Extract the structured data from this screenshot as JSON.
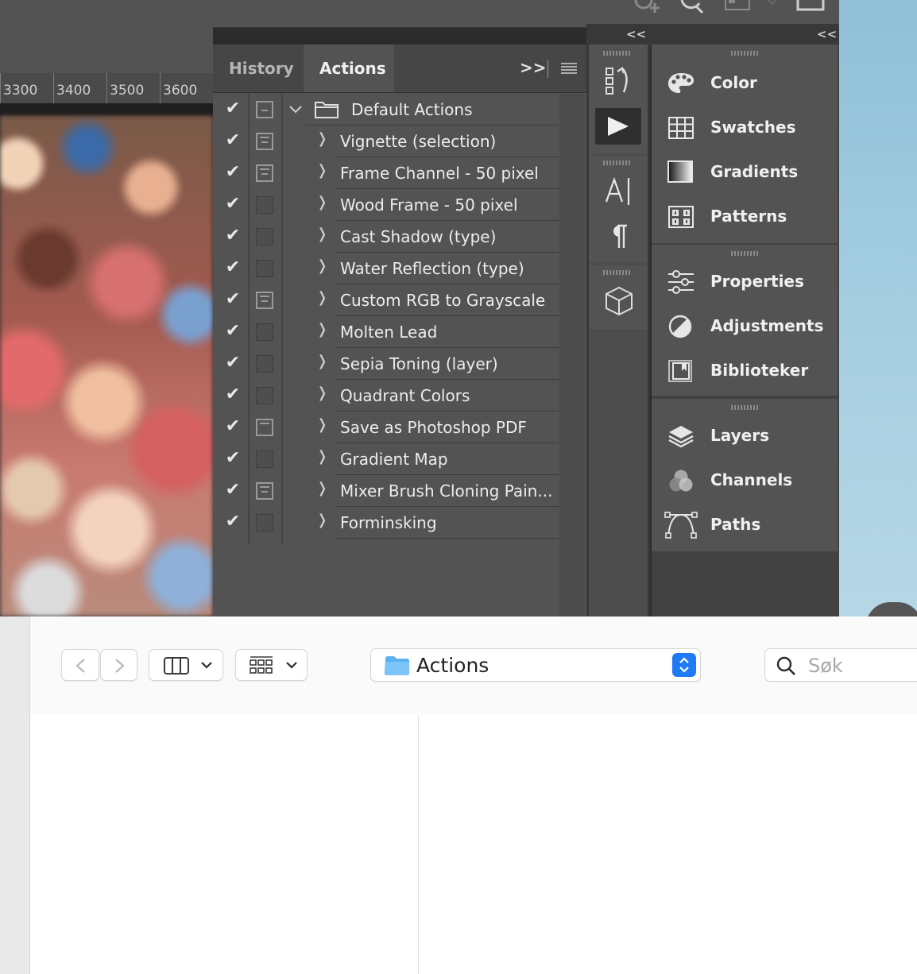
{
  "ruler": {
    "ticks": [
      "3300",
      "3400",
      "3500",
      "3600"
    ]
  },
  "actions_panel": {
    "tabs": [
      {
        "label": "History"
      },
      {
        "label": "Actions"
      }
    ],
    "expand_label": ">>",
    "set": {
      "name": "Default Actions"
    },
    "actions": [
      {
        "name": "Vignette (selection)",
        "dialog": true
      },
      {
        "name": "Frame Channel - 50 pixel",
        "dialog": true
      },
      {
        "name": "Wood Frame - 50 pixel",
        "dialog": false
      },
      {
        "name": "Cast Shadow (type)",
        "dialog": false
      },
      {
        "name": "Water Reflection (type)",
        "dialog": false
      },
      {
        "name": "Custom RGB to Grayscale",
        "dialog": true
      },
      {
        "name": "Molten Lead",
        "dialog": false
      },
      {
        "name": "Sepia Toning (layer)",
        "dialog": false
      },
      {
        "name": "Quadrant Colors",
        "dialog": false
      },
      {
        "name": "Save as Photoshop PDF",
        "dialog": true
      },
      {
        "name": "Gradient Map",
        "dialog": false
      },
      {
        "name": "Mixer Brush Cloning Pain...",
        "dialog": true
      },
      {
        "name": "Forminsking",
        "dialog": false
      }
    ]
  },
  "right_panel": {
    "collapse_label": "<<",
    "groups": [
      {
        "items": [
          {
            "label": "Color",
            "icon": "palette-icon"
          },
          {
            "label": "Swatches",
            "icon": "grid-icon"
          },
          {
            "label": "Gradients",
            "icon": "gradient-icon"
          },
          {
            "label": "Patterns",
            "icon": "pattern-icon"
          }
        ]
      },
      {
        "items": [
          {
            "label": "Properties",
            "icon": "sliders-icon"
          },
          {
            "label": "Adjustments",
            "icon": "half-circle-icon"
          },
          {
            "label": "Biblioteker",
            "icon": "library-icon"
          }
        ]
      },
      {
        "items": [
          {
            "label": "Layers",
            "icon": "layers-icon"
          },
          {
            "label": "Channels",
            "icon": "channels-icon"
          },
          {
            "label": "Paths",
            "icon": "pen-path-icon"
          }
        ]
      }
    ]
  },
  "finder": {
    "path_label": "Actions",
    "search_placeholder": "Søk"
  },
  "colors": {
    "panel_bg": "#535353",
    "finder_accent": "#1f7bf5"
  }
}
